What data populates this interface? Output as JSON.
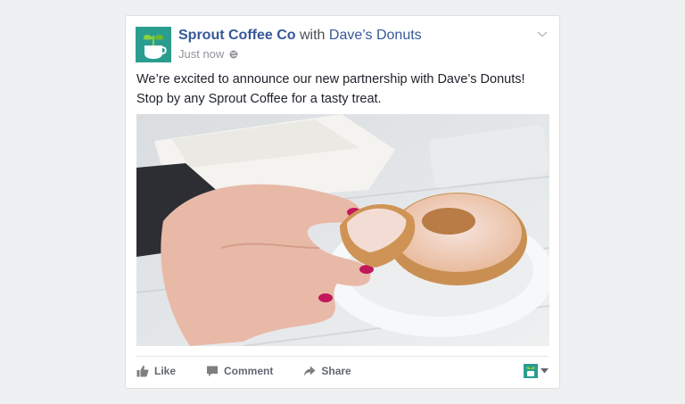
{
  "post": {
    "page_name": "Sprout Coffee Co",
    "with_text": "with",
    "tagged_page": "Dave’s Donuts",
    "timestamp": "Just now",
    "privacy_icon": "globe-icon",
    "text_line1": "We’re excited to announce our new partnership with Dave’s Donuts!",
    "text_line2": "Stop by any Sprout Coffee for a tasty treat.",
    "photo_subject": "hand-holding-glazed-donut"
  },
  "actions": {
    "like": "Like",
    "comment": "Comment",
    "share": "Share"
  },
  "colors": {
    "link_blue": "#365899",
    "brand_teal": "#2a9d8f",
    "muted_text": "#90949c",
    "background": "#eff0f1"
  }
}
